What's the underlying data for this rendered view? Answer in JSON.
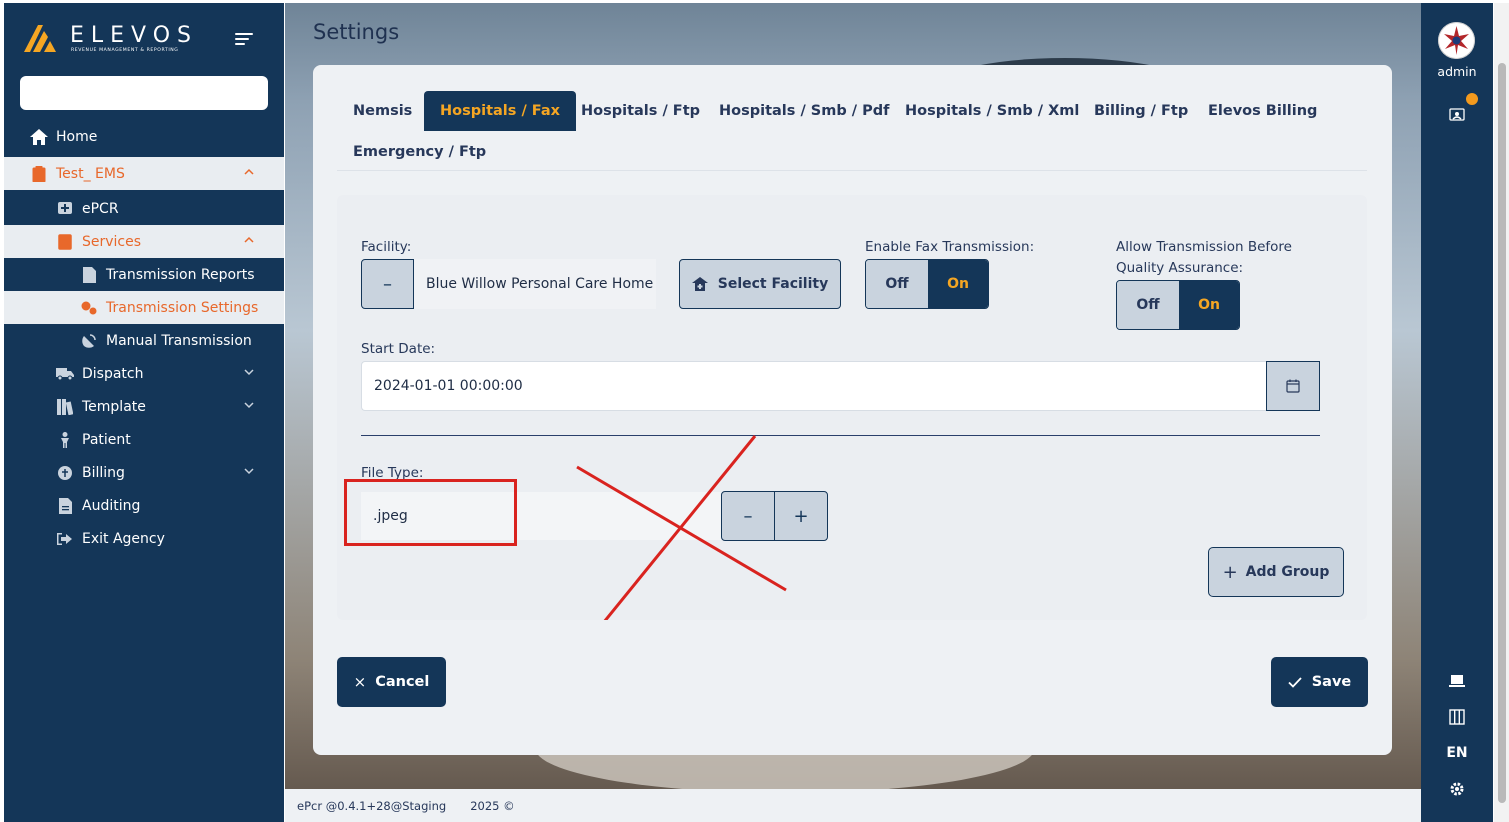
{
  "brand": {
    "name": "ELEVOS",
    "tagline": "REVENUE MANAGEMENT & REPORTING"
  },
  "search": {
    "placeholder": ""
  },
  "sidebar": {
    "items": [
      {
        "label": "Home",
        "icon": "home-icon"
      },
      {
        "label": "Test_ EMS",
        "icon": "clipboard-icon"
      },
      {
        "label": "ePCR",
        "icon": "medical-plus-icon"
      },
      {
        "label": "Services",
        "icon": "services-icon"
      },
      {
        "label": "Transmission Reports",
        "icon": "document-icon"
      },
      {
        "label": "Transmission Settings",
        "icon": "settings-gears-icon"
      },
      {
        "label": "Manual Transmission",
        "icon": "satellite-icon"
      },
      {
        "label": "Dispatch",
        "icon": "truck-icon"
      },
      {
        "label": "Template",
        "icon": "template-icon"
      },
      {
        "label": "Patient",
        "icon": "person-icon"
      },
      {
        "label": "Billing",
        "icon": "billing-icon"
      },
      {
        "label": "Auditing",
        "icon": "audit-icon"
      },
      {
        "label": "Exit Agency",
        "icon": "exit-icon"
      }
    ]
  },
  "page": {
    "title": "Settings"
  },
  "tabs": [
    {
      "label": "Nemsis"
    },
    {
      "label": "Hospitals / Fax"
    },
    {
      "label": "Hospitals / Ftp"
    },
    {
      "label": "Hospitals / Smb / Pdf"
    },
    {
      "label": "Hospitals / Smb / Xml"
    },
    {
      "label": "Billing / Ftp"
    },
    {
      "label": "Elevos Billing"
    },
    {
      "label": "Emergency / Ftp"
    }
  ],
  "form": {
    "facility_label": "Facility:",
    "facility_minus": "–",
    "facility_value": "Blue Willow Personal Care Home",
    "select_facility": "Select Facility",
    "enable_fax_label": "Enable Fax Transmission:",
    "allow_before_qa_label_1": "Allow Transmission Before",
    "allow_before_qa_label_2": "Quality Assurance:",
    "off": "Off",
    "on": "On",
    "start_date_label": "Start Date:",
    "start_date_value": "2024-01-01 00:00:00",
    "file_type_label": "File Type:",
    "file_type_value": ".jpeg",
    "minus": "–",
    "plus": "+",
    "add_group": "Add Group"
  },
  "actions": {
    "cancel": "Cancel",
    "save": "Save"
  },
  "footer": {
    "version": "ePcr @0.4.1+28@Staging",
    "year": "2025 ©"
  },
  "rail": {
    "user": "admin",
    "lang": "EN"
  },
  "colors": {
    "navy": "#143658",
    "accent": "#f5a623",
    "active_orange": "#e8682b",
    "annotation_red": "#d9231f"
  }
}
